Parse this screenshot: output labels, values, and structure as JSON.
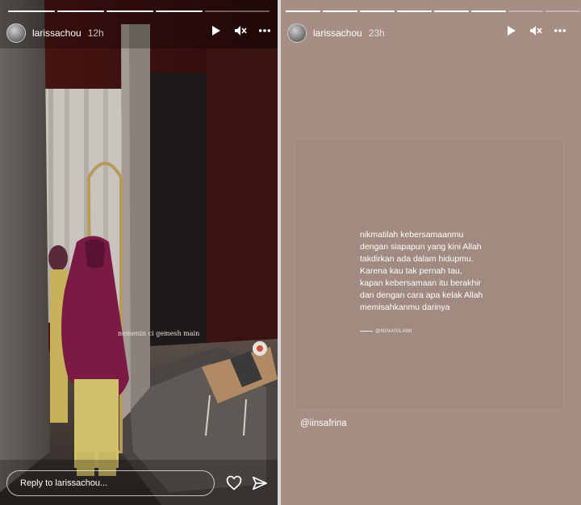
{
  "left_story": {
    "username": "larissachou",
    "time_ago": "12h",
    "caption": "nemenin ci gemesh main",
    "reply_placeholder": "Reply to larissachou...",
    "progress_segments": [
      1,
      1,
      1,
      1,
      0
    ],
    "icons": [
      "play-icon",
      "mute-icon",
      "more-icon",
      "heart-icon",
      "send-icon"
    ]
  },
  "right_story": {
    "username": "larissachou",
    "time_ago": "23h",
    "progress_segments": [
      1,
      1,
      1,
      1,
      1,
      1,
      0,
      0
    ],
    "quote_lines": [
      "nikmatilah kebersamaanmu",
      "dengan siapapun yang kini Allah",
      "takdirkan ada dalam hidupmu.",
      "Karena kau tak pernah tau,",
      "kapan kebersamaan itu berakhir",
      "dan dengan cara apa kelak Allah",
      "memisahkanmu darinya"
    ],
    "quote_signature": "@NINAISLAMI",
    "mention": "@iinsafrina",
    "background_color": "#a68e84"
  }
}
